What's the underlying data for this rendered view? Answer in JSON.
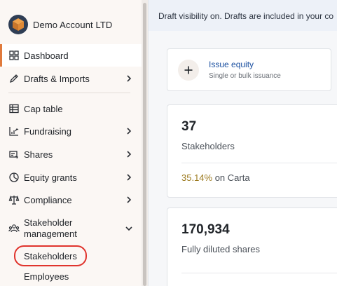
{
  "account": {
    "name": "Demo Account LTD"
  },
  "sidebar": {
    "items": [
      {
        "label": "Dashboard",
        "icon": "dashboard-grid-icon",
        "active": true,
        "chevron": ""
      },
      {
        "label": "Drafts & Imports",
        "icon": "pencil-icon",
        "chevron": "right"
      },
      {
        "label": "Cap table",
        "icon": "table-icon",
        "chevron": ""
      },
      {
        "label": "Fundraising",
        "icon": "bar-chart-icon",
        "chevron": "right"
      },
      {
        "label": "Shares",
        "icon": "shares-icon",
        "chevron": "right"
      },
      {
        "label": "Equity grants",
        "icon": "pie-icon",
        "chevron": "right"
      },
      {
        "label": "Compliance",
        "icon": "scale-icon",
        "chevron": "right"
      },
      {
        "label_line1": "Stakeholder",
        "label_line2": "management",
        "icon": "people-icon",
        "chevron": "down"
      }
    ],
    "sub_items": [
      {
        "label": "Stakeholders",
        "highlighted": true
      },
      {
        "label": "Employees"
      }
    ]
  },
  "banner": {
    "text": "Draft visibility on. Drafts are included in your co"
  },
  "issue_equity": {
    "title": "Issue equity",
    "subtitle": "Single or bulk issuance"
  },
  "stats": {
    "stakeholders": {
      "value": "37",
      "label": "Stakeholders",
      "pct": "35.14%",
      "pct_suffix": " on Carta"
    },
    "shares": {
      "value": "170,934",
      "label": "Fully diluted shares"
    }
  },
  "colors": {
    "accent": "#e07a3c",
    "link": "#1a4fa0",
    "highlight_ring": "#e0342d",
    "pct": "#9c7a1e"
  }
}
